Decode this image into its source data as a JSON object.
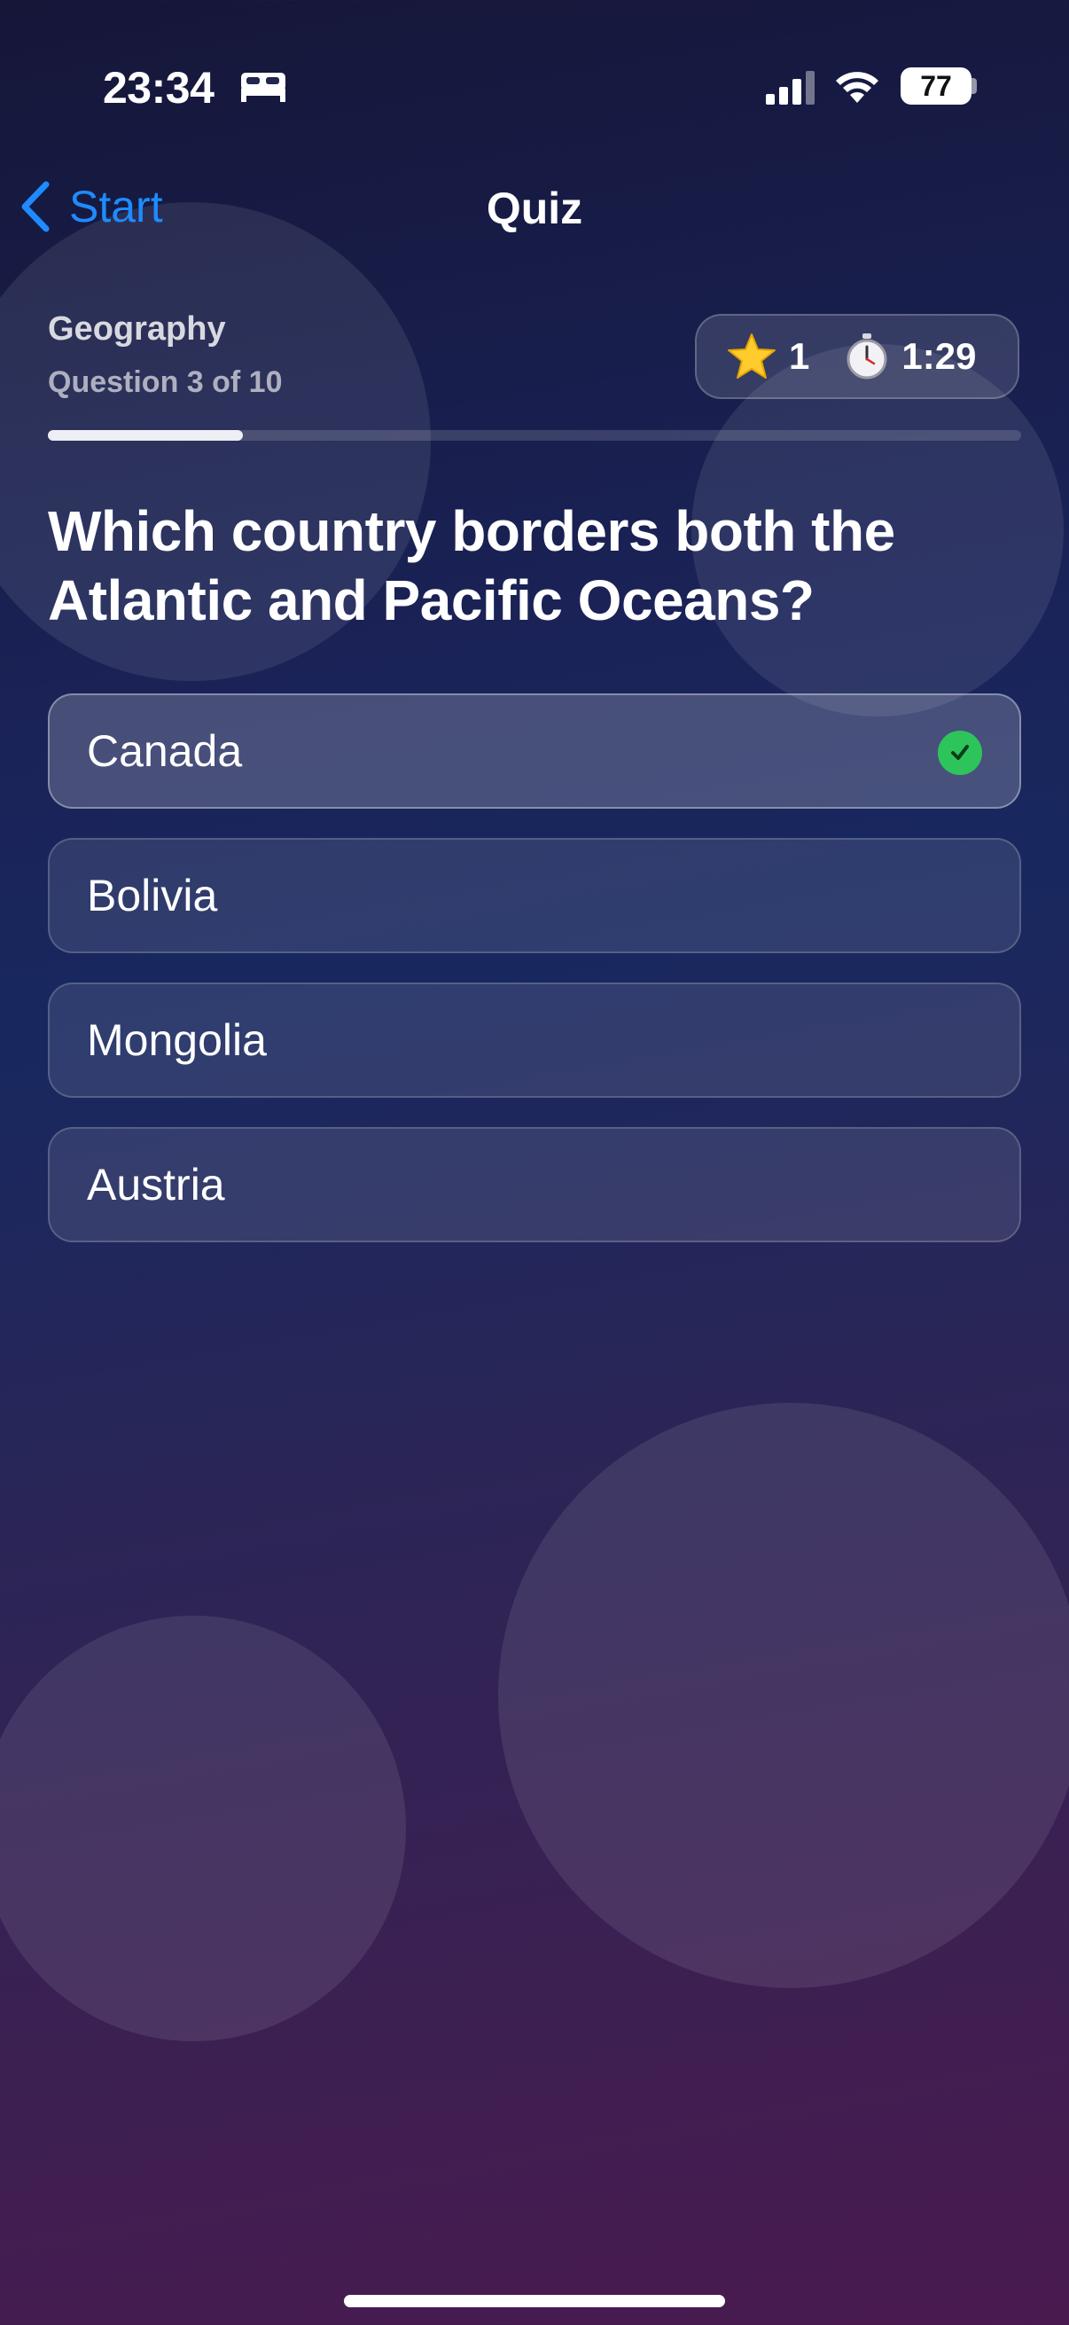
{
  "status_bar": {
    "time": "23:34",
    "battery": "77"
  },
  "nav": {
    "back_label": "Start",
    "title": "Quiz"
  },
  "quiz": {
    "category": "Geography",
    "question_counter": "Question 3 of 10",
    "score": "1",
    "timer": "1:29",
    "progress": 0.2,
    "question": "Which country borders both the Atlantic and Pacific Oceans?",
    "answers": [
      {
        "label": "Canada",
        "selected": true
      },
      {
        "label": "Bolivia",
        "selected": false
      },
      {
        "label": "Mongolia",
        "selected": false
      },
      {
        "label": "Austria",
        "selected": false
      }
    ]
  },
  "colors": {
    "accent": "#1e8bff",
    "correct": "#2ec45c"
  }
}
